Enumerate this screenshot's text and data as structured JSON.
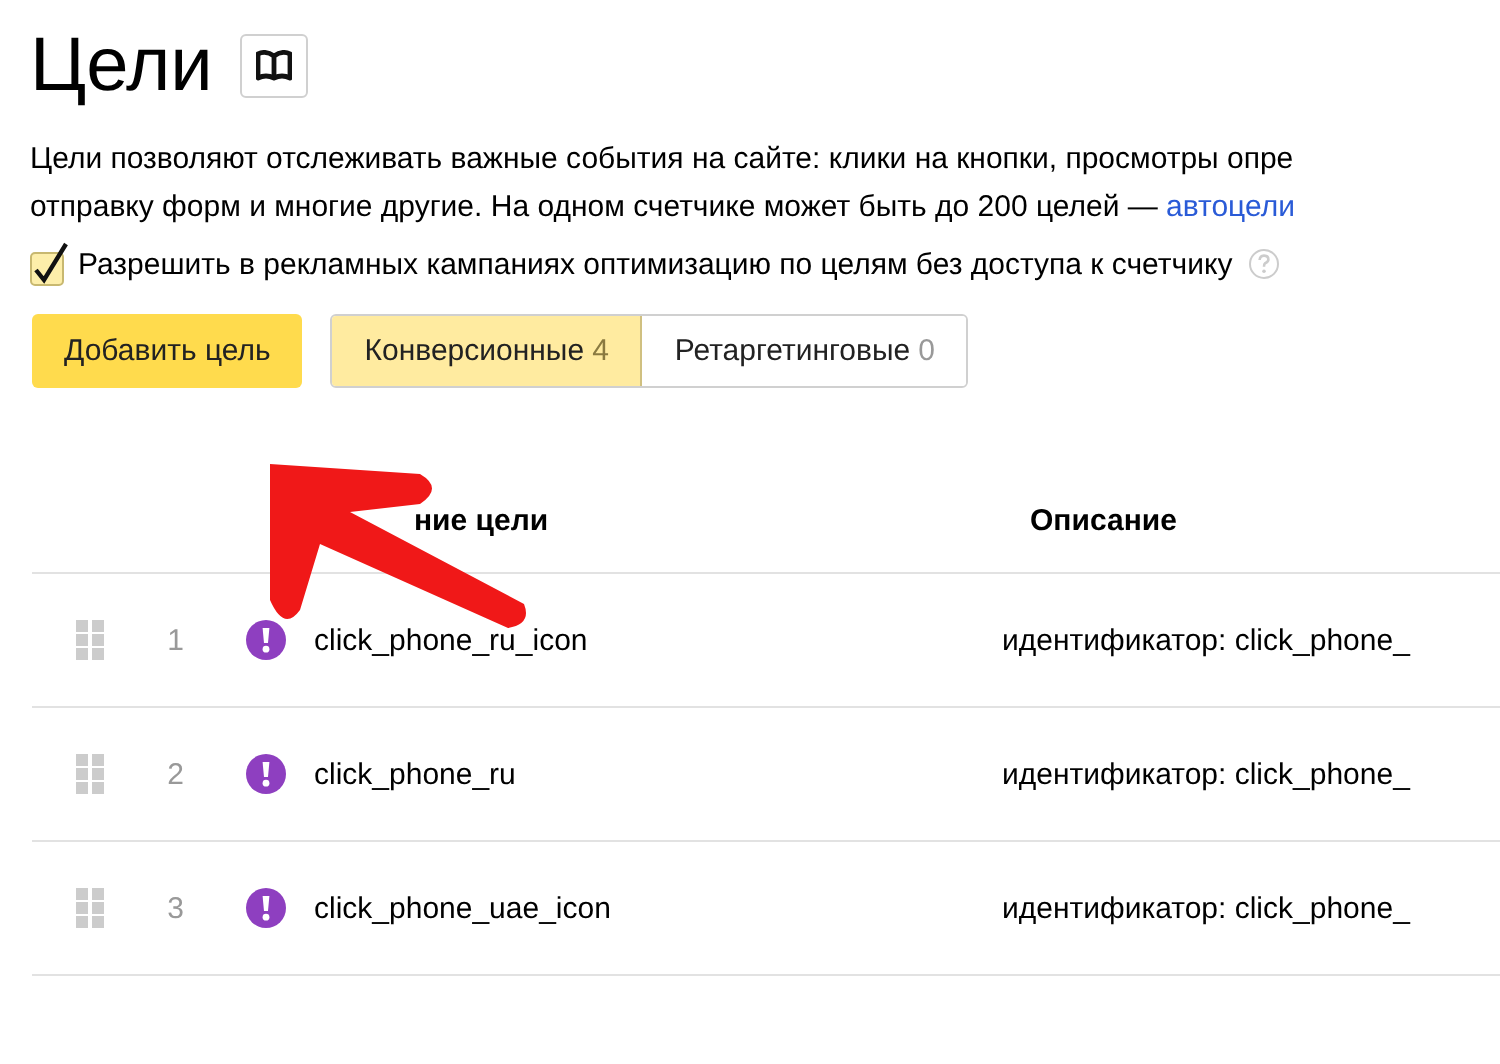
{
  "title": "Цели",
  "description": {
    "line_1": "Цели позволяют отслеживать важные события на сайте: клики на кнопки, просмотры опре",
    "line_2": "отправку форм и многие другие. На одном счетчике может быть до 200 целей — ",
    "link": "автоцели"
  },
  "option": {
    "label": "Разрешить в рекламных кампаниях оптимизацию по целям без доступа к счетчику",
    "checked": true
  },
  "add_button": "Добавить цель",
  "tabs": [
    {
      "label": "Конверсионные",
      "count": "4",
      "selected": true
    },
    {
      "label": "Ретаргетинговые",
      "count": "0",
      "selected": false
    }
  ],
  "table": {
    "columns": [
      "ние цели",
      "Описание"
    ],
    "rows": [
      {
        "number": "1",
        "name": "click_phone_ru_icon",
        "description": "идентификатор: click_phone_"
      },
      {
        "number": "2",
        "name": "click_phone_ru",
        "description": "идентификатор: click_phone_"
      },
      {
        "number": "3",
        "name": "click_phone_uae_icon",
        "description": "идентификатор: click_phone_"
      }
    ]
  }
}
